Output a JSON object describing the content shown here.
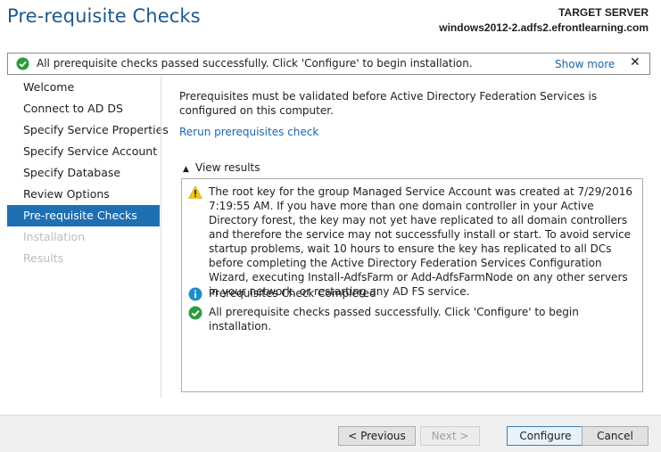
{
  "window": {
    "title": "Pre-requisite Checks"
  },
  "target": {
    "label": "TARGET SERVER",
    "server": "windows2012-2.adfs2.efrontlearning.com"
  },
  "banner": {
    "icon": "check-circle-icon",
    "message": "All prerequisite checks passed successfully.  Click 'Configure' to begin installation.",
    "show_more": "Show more",
    "close": "✕"
  },
  "nav": {
    "items": [
      {
        "label": "Welcome",
        "state": "normal"
      },
      {
        "label": "Connect to AD DS",
        "state": "normal"
      },
      {
        "label": "Specify Service Properties",
        "state": "normal"
      },
      {
        "label": "Specify Service Account",
        "state": "normal"
      },
      {
        "label": "Specify Database",
        "state": "normal"
      },
      {
        "label": "Review Options",
        "state": "normal"
      },
      {
        "label": "Pre-requisite Checks",
        "state": "active"
      },
      {
        "label": "Installation",
        "state": "disabled"
      },
      {
        "label": "Results",
        "state": "disabled"
      }
    ]
  },
  "main": {
    "intro": "Prerequisites must be validated before Active Directory Federation Services is configured on this computer.",
    "rerun_link": "Rerun prerequisites check",
    "view_results": "View results",
    "results": [
      {
        "icon": "warning-icon",
        "text": "The root key for the group Managed Service Account was created at 7/29/2016 7:19:55 AM. If you have more than one domain controller in your Active Directory forest, the key may not yet have replicated to all domain controllers and therefore the service may not successfully install or start.  To avoid service startup problems, wait 10 hours to ensure the key has replicated to all DCs before completing the Active Directory Federation Services Configuration Wizard, executing Install-AdfsFarm or Add-AdfsFarmNode on any other servers in your network, or restarting any AD FS service."
      },
      {
        "icon": "info-icon",
        "text": "Prerequisites Check Completed"
      },
      {
        "icon": "check-circle-icon",
        "text": "All prerequisite checks passed successfully.  Click 'Configure' to begin installation."
      }
    ]
  },
  "footer": {
    "previous": "< Previous",
    "next": "Next >",
    "configure": "Configure",
    "cancel": "Cancel"
  },
  "colors": {
    "title": "#1c5a8e",
    "accent": "#1f6fb3",
    "link": "#1a66a8",
    "success": "#2e9a3c",
    "warning": "#f2c811",
    "info": "#1e8fc6"
  }
}
